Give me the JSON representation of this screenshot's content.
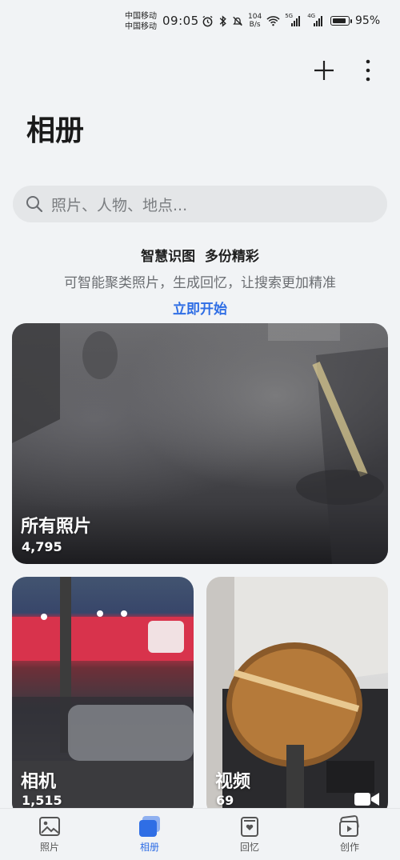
{
  "status_bar": {
    "carrier_1": "中国移动",
    "carrier_2": "中国移动",
    "time": "09:05",
    "net_speed_value": "104",
    "net_speed_unit": "B/s",
    "signal_1_label": "5G",
    "signal_2_label": "4G",
    "battery_percent": "95%",
    "battery_level": 0.95
  },
  "header": {
    "title": "相册",
    "add_icon": "plus-icon",
    "more_icon": "more-vertical-icon"
  },
  "search": {
    "placeholder": "照片、人物、地点..."
  },
  "promo": {
    "title": "智慧识图  多份精彩",
    "description": "可智能聚类照片，生成回忆，让搜索更加精准",
    "link": "立即开始"
  },
  "albums": [
    {
      "name": "所有照片",
      "count": "4,795"
    },
    {
      "name": "相机",
      "count": "1,515"
    },
    {
      "name": "视频",
      "count": "69",
      "icon": "video-camera-icon"
    }
  ],
  "bottom_nav": {
    "active_color": "#2f6ee5",
    "tabs": [
      {
        "label": "照片",
        "icon": "photo-icon",
        "active": false
      },
      {
        "label": "相册",
        "icon": "album-icon",
        "active": true
      },
      {
        "label": "回忆",
        "icon": "memories-icon",
        "active": false
      },
      {
        "label": "创作",
        "icon": "create-icon",
        "active": false
      }
    ]
  }
}
